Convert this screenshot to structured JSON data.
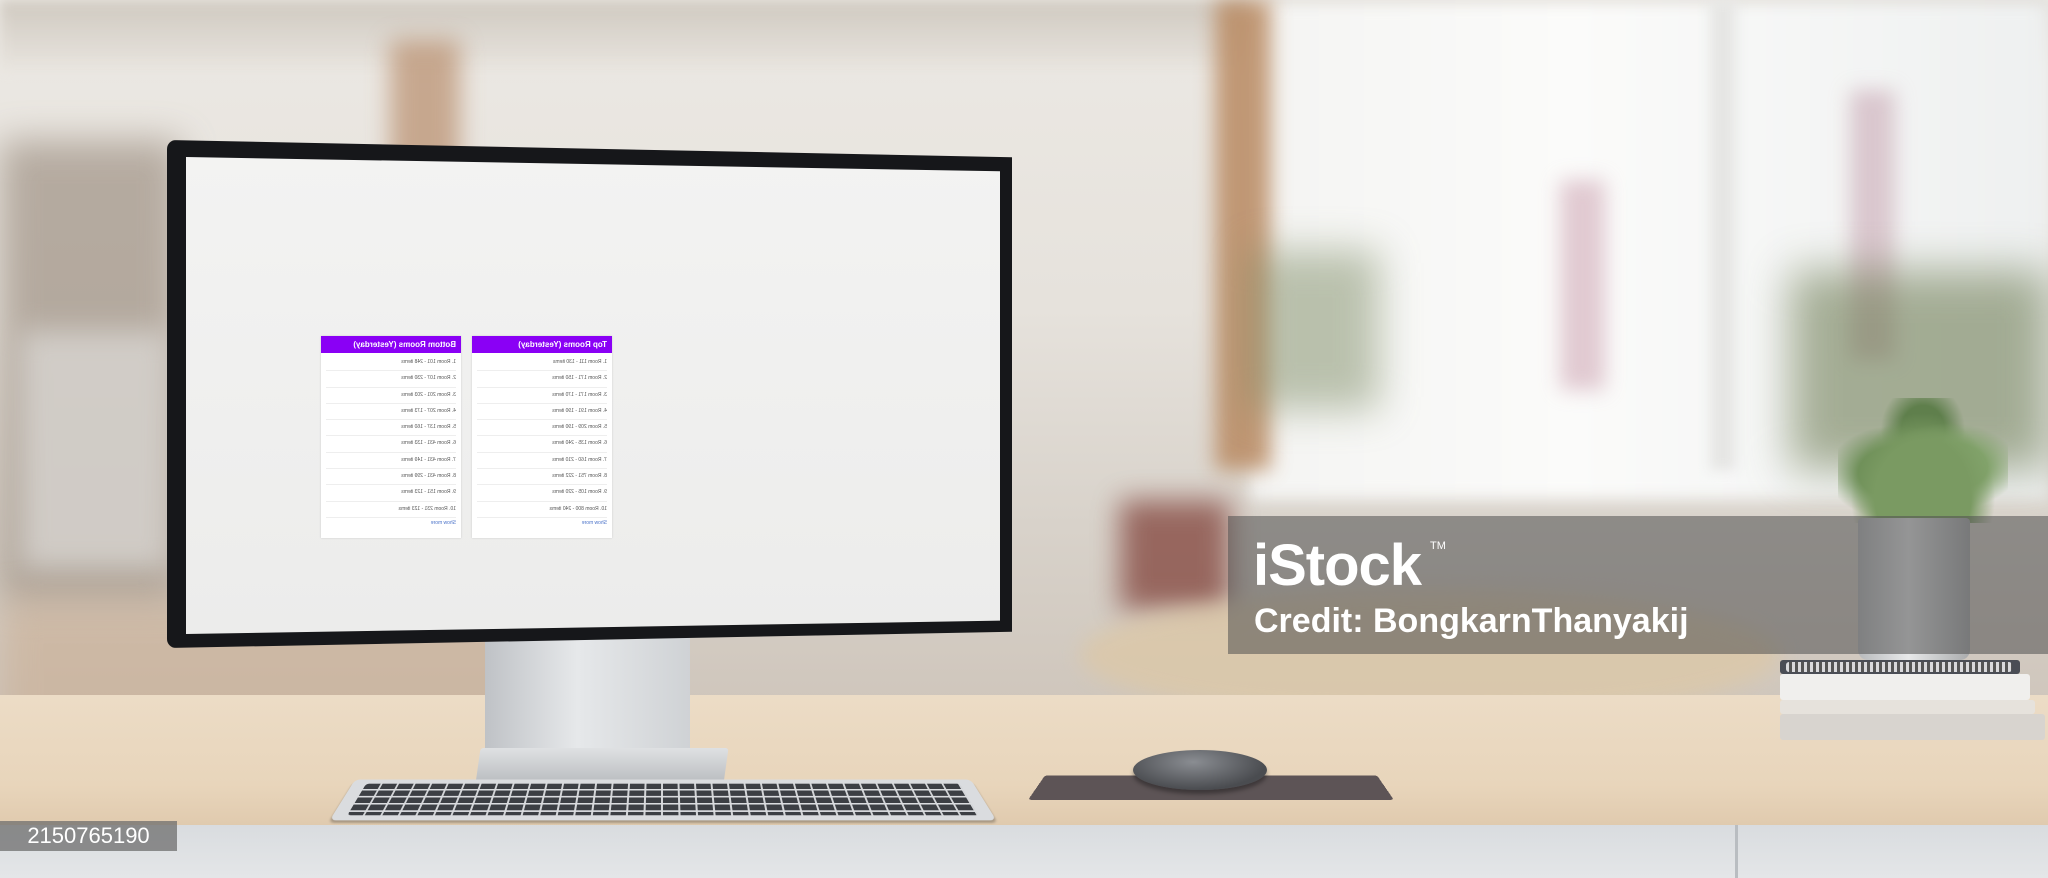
{
  "screen": {
    "bottom_panel": {
      "title": "Bottom Rooms (Yesterday)",
      "items": [
        "1. Room 101 - 248 items",
        "2. Room 107 - 230 items",
        "3. Room 201 - 203 items",
        "4. Room 207 - 173 items",
        "5. Room 137 - 160 items",
        "6. Room 431 - 133 items",
        "7. Room 431 - 149 items",
        "8. Room 431 - 299 items",
        "9. Room 151 - 123 items",
        "10. Room 231 - 123 items"
      ],
      "more_link": "Show more"
    },
    "top_panel": {
      "title": "Top Rooms (Yesterday)",
      "items": [
        "1. Room 111 - 130 items",
        "2. Room 171 - 150 items",
        "3. Room 171 - 170 items",
        "4. Room 191 - 190 items",
        "5. Room 209 - 190 items",
        "6. Room 135 - 240 items",
        "7. Room 160 - 210 items",
        "8. Room 751 - 222 items",
        "9. Room 105 - 220 items",
        "10. Room 800 - 240 items"
      ],
      "more_link": "Show more"
    },
    "accent_color": "#8a00f5"
  },
  "watermark": {
    "logo": "iStock",
    "tm": "TM",
    "credit": "Credit: BongkarnThanyakij",
    "stock_id": "2150765190"
  }
}
